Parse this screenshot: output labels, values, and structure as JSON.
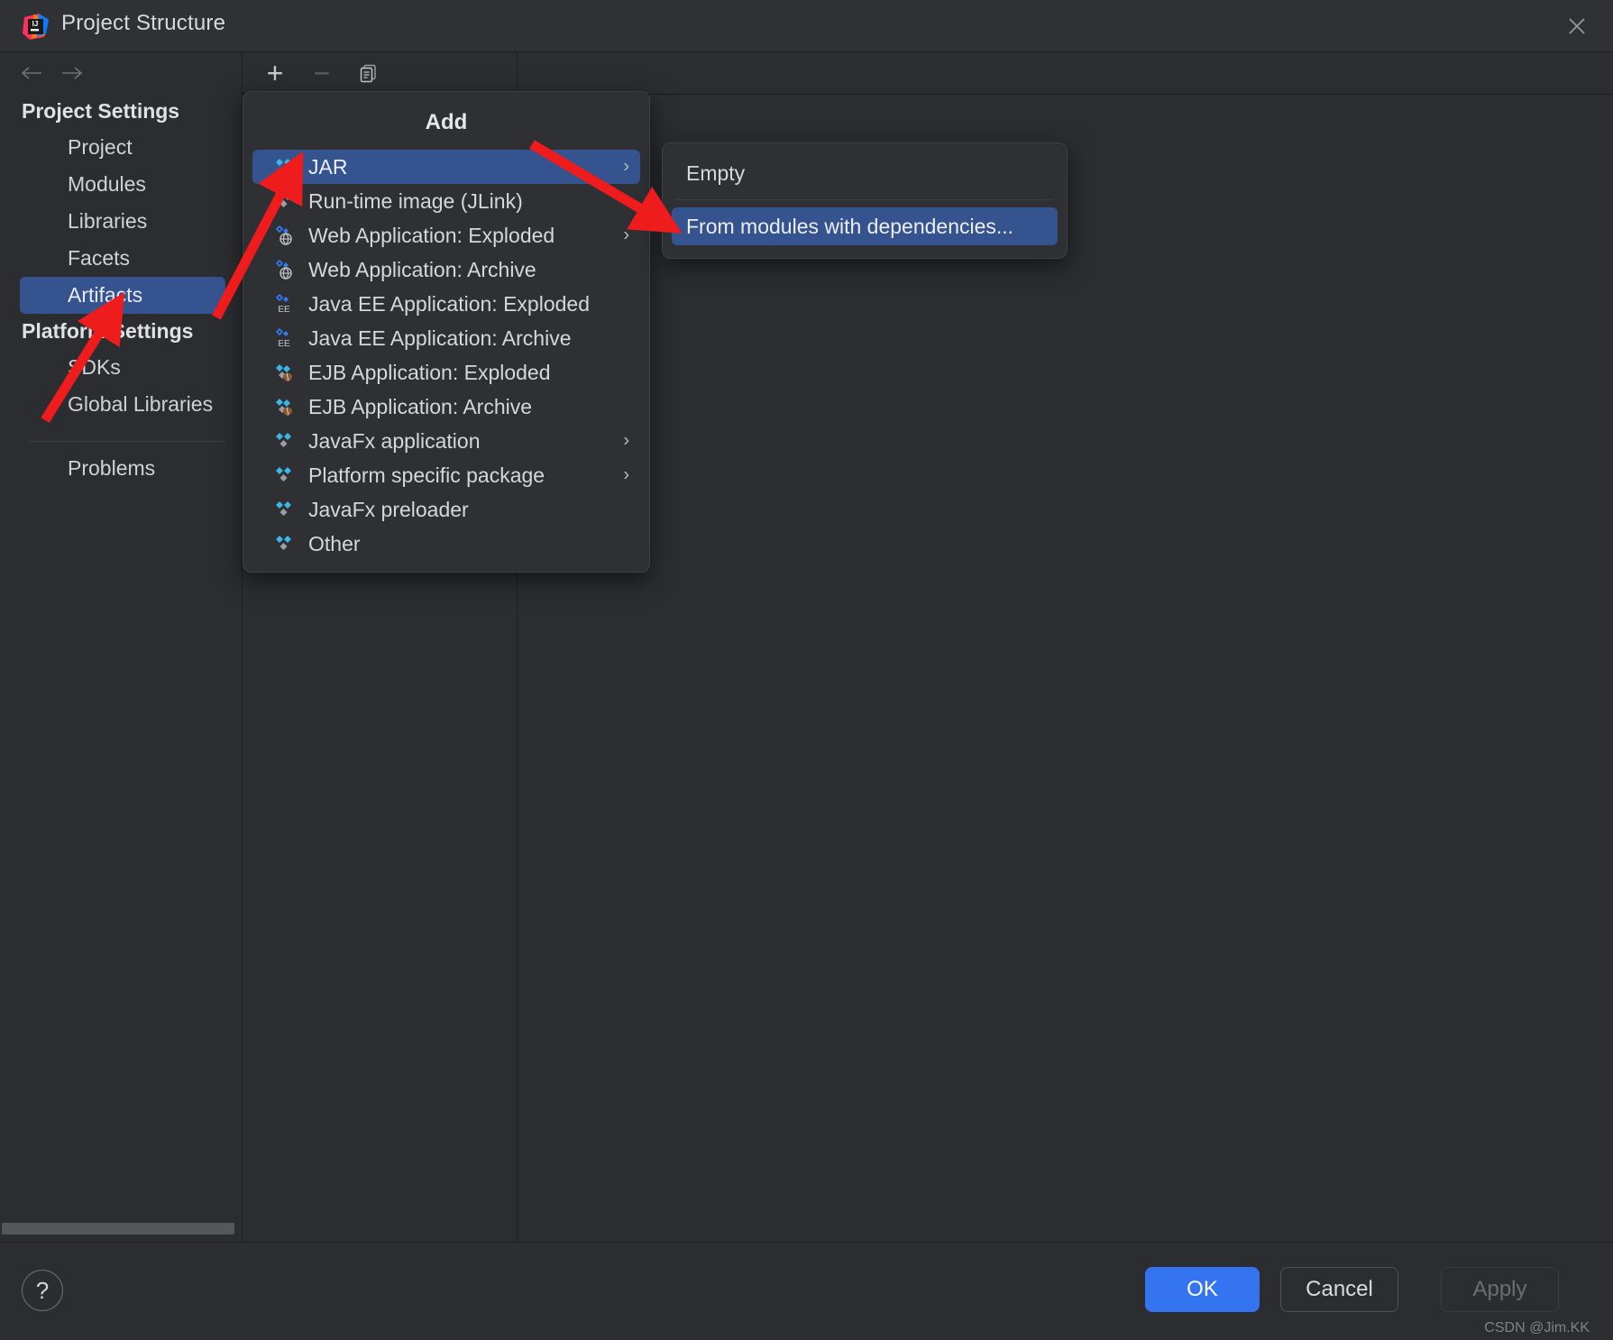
{
  "window": {
    "title": "Project Structure",
    "logo_icon": "intellij-idea-logo",
    "close_icon": "close-icon"
  },
  "nav": {
    "back_icon": "arrow-left-icon",
    "forward_icon": "arrow-right-icon"
  },
  "toolbar": {
    "add_icon": "plus-icon",
    "remove_icon": "minus-icon",
    "copy_icon": "copy-icon"
  },
  "sidebar": {
    "groups": [
      {
        "label": "Project Settings",
        "items": [
          {
            "label": "Project",
            "selected": false
          },
          {
            "label": "Modules",
            "selected": false
          },
          {
            "label": "Libraries",
            "selected": false
          },
          {
            "label": "Facets",
            "selected": false
          },
          {
            "label": "Artifacts",
            "selected": true
          }
        ]
      },
      {
        "label": "Platform Settings",
        "items": [
          {
            "label": "SDKs",
            "selected": false
          },
          {
            "label": "Global Libraries",
            "selected": false
          }
        ]
      }
    ],
    "problems_label": "Problems"
  },
  "add_menu": {
    "title": "Add",
    "items": [
      {
        "label": "JAR",
        "icon": "artifact-jar-icon",
        "selected": true,
        "submenu": true
      },
      {
        "label": "Run-time image (JLink)",
        "icon": "artifact-jlink-icon",
        "selected": false,
        "submenu": false
      },
      {
        "label": "Web Application: Exploded",
        "icon": "artifact-web-icon",
        "selected": false,
        "submenu": true
      },
      {
        "label": "Web Application: Archive",
        "icon": "artifact-web-icon",
        "selected": false,
        "submenu": false
      },
      {
        "label": "Java EE Application: Exploded",
        "icon": "artifact-javaee-icon",
        "selected": false,
        "submenu": false
      },
      {
        "label": "Java EE Application: Archive",
        "icon": "artifact-javaee-icon",
        "selected": false,
        "submenu": false
      },
      {
        "label": "EJB Application: Exploded",
        "icon": "artifact-ejb-icon",
        "selected": false,
        "submenu": false
      },
      {
        "label": "EJB Application: Archive",
        "icon": "artifact-ejb-icon",
        "selected": false,
        "submenu": false
      },
      {
        "label": "JavaFx application",
        "icon": "artifact-javafx-icon",
        "selected": false,
        "submenu": true
      },
      {
        "label": "Platform specific package",
        "icon": "artifact-platform-icon",
        "selected": false,
        "submenu": true
      },
      {
        "label": "JavaFx preloader",
        "icon": "artifact-javafx-icon",
        "selected": false,
        "submenu": false
      },
      {
        "label": "Other",
        "icon": "artifact-other-icon",
        "selected": false,
        "submenu": false
      }
    ]
  },
  "jar_submenu": {
    "items": [
      {
        "label": "Empty",
        "selected": false
      },
      {
        "label": "From modules with dependencies...",
        "selected": true
      }
    ]
  },
  "footer": {
    "help_label": "?",
    "ok_label": "OK",
    "cancel_label": "Cancel",
    "apply_label": "Apply",
    "watermark": "CSDN @Jim.KK"
  },
  "colors": {
    "selection_blue": "#35538f",
    "primary_button": "#3574f0",
    "annotation_red": "#ee1c1c",
    "window_bg": "#2b2d30"
  }
}
